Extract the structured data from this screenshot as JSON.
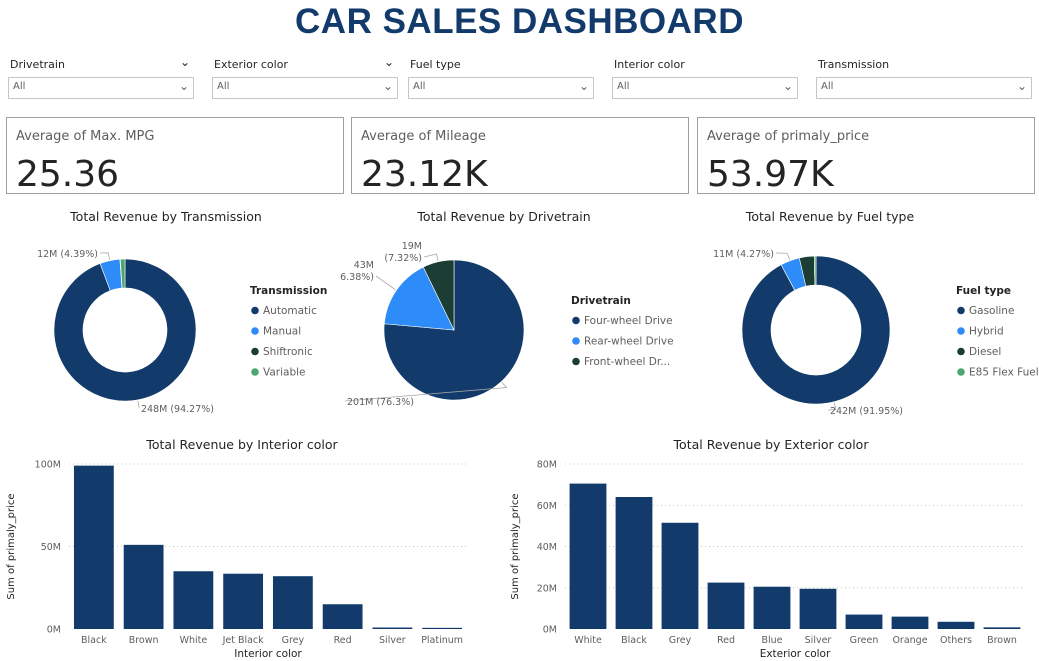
{
  "dashboard_title": "CAR SALES DASHBOARD",
  "slicers": [
    {
      "label": "Drivetrain",
      "value": "All"
    },
    {
      "label": "Exterior color",
      "value": "All"
    },
    {
      "label": "Fuel type",
      "value": "All"
    },
    {
      "label": "Interior color",
      "value": "All"
    },
    {
      "label": "Transmission",
      "value": "All"
    }
  ],
  "cards": [
    {
      "label": "Average of Max. MPG",
      "value": "25.36"
    },
    {
      "label": "Average of Mileage",
      "value": "23.12K"
    },
    {
      "label": "Average of primaly_price",
      "value": "53.97K"
    }
  ],
  "colors": {
    "title": "#123a6b",
    "navy": "#123b6b",
    "blue": "#2e8cf8",
    "dark_green": "#1b3d34",
    "green": "#4ca66e"
  },
  "chart_data": [
    {
      "type": "pie",
      "variant": "donut",
      "title": "Total Revenue by Transmission",
      "legend_title": "Transmission",
      "legend_position": "right",
      "labels": [
        "Automatic",
        "Manual",
        "Shiftronic",
        "Variable"
      ],
      "values": [
        248,
        12,
        0.2,
        2.8
      ],
      "colors": [
        "#123b6b",
        "#2e8cf8",
        "#1b3d34",
        "#4ca66e"
      ],
      "data_labels": [
        "248M (94.27%)",
        "12M (4.39%)",
        "",
        ""
      ]
    },
    {
      "type": "pie",
      "title": "Total Revenue by Drivetrain",
      "legend_title": "Drivetrain",
      "legend_position": "right",
      "labels": [
        "Four-wheel Drive",
        "Rear-wheel Drive",
        "Front-wheel Dr..."
      ],
      "values": [
        201,
        43,
        19
      ],
      "colors": [
        "#123b6b",
        "#2e8cf8",
        "#1b3d34"
      ],
      "data_labels": [
        "201M (76.3%)",
        "43M\n(16.38%)",
        "19M\n(7.32%)"
      ]
    },
    {
      "type": "pie",
      "variant": "donut",
      "title": "Total Revenue by Fuel type",
      "legend_title": "Fuel type",
      "legend_position": "right",
      "labels": [
        "Gasoline",
        "Hybrid",
        "Diesel",
        "E85 Flex Fuel"
      ],
      "values": [
        242,
        11,
        8.5,
        1.0
      ],
      "colors": [
        "#123b6b",
        "#2e8cf8",
        "#1b3d34",
        "#4ca66e"
      ],
      "data_labels": [
        "242M (91.95%)",
        "11M (4.27%)",
        "",
        ""
      ]
    },
    {
      "type": "bar",
      "title": "Total Revenue by Interior color",
      "xlabel": "Interior color",
      "ylabel": "Sum of primaly_price",
      "categories": [
        "Black",
        "Brown",
        "White",
        "Jet Black",
        "Grey",
        "Red",
        "Silver",
        "Platinum"
      ],
      "values": [
        99,
        51,
        35,
        33.5,
        32,
        15,
        0.9,
        0.7
      ],
      "ylim": [
        0,
        100
      ],
      "yticks": [
        {
          "v": 0,
          "label": "0M"
        },
        {
          "v": 50,
          "label": "50M"
        },
        {
          "v": 100,
          "label": "100M"
        }
      ],
      "grid": true,
      "color": "#123b6b"
    },
    {
      "type": "bar",
      "title": "Total Revenue by Exterior color",
      "xlabel": "Exterior color",
      "ylabel": "Sum of primaly_price",
      "categories": [
        "White",
        "Black",
        "Grey",
        "Red",
        "Blue",
        "Silver",
        "Green",
        "Orange",
        "Others",
        "Brown"
      ],
      "values": [
        70.5,
        64,
        51.5,
        22.5,
        20.5,
        19.5,
        7,
        6,
        3.5,
        0.8
      ],
      "ylim": [
        0,
        80
      ],
      "yticks": [
        {
          "v": 0,
          "label": "0M"
        },
        {
          "v": 20,
          "label": "20M"
        },
        {
          "v": 40,
          "label": "40M"
        },
        {
          "v": 60,
          "label": "60M"
        },
        {
          "v": 80,
          "label": "80M"
        }
      ],
      "grid": true,
      "color": "#123b6b"
    }
  ]
}
